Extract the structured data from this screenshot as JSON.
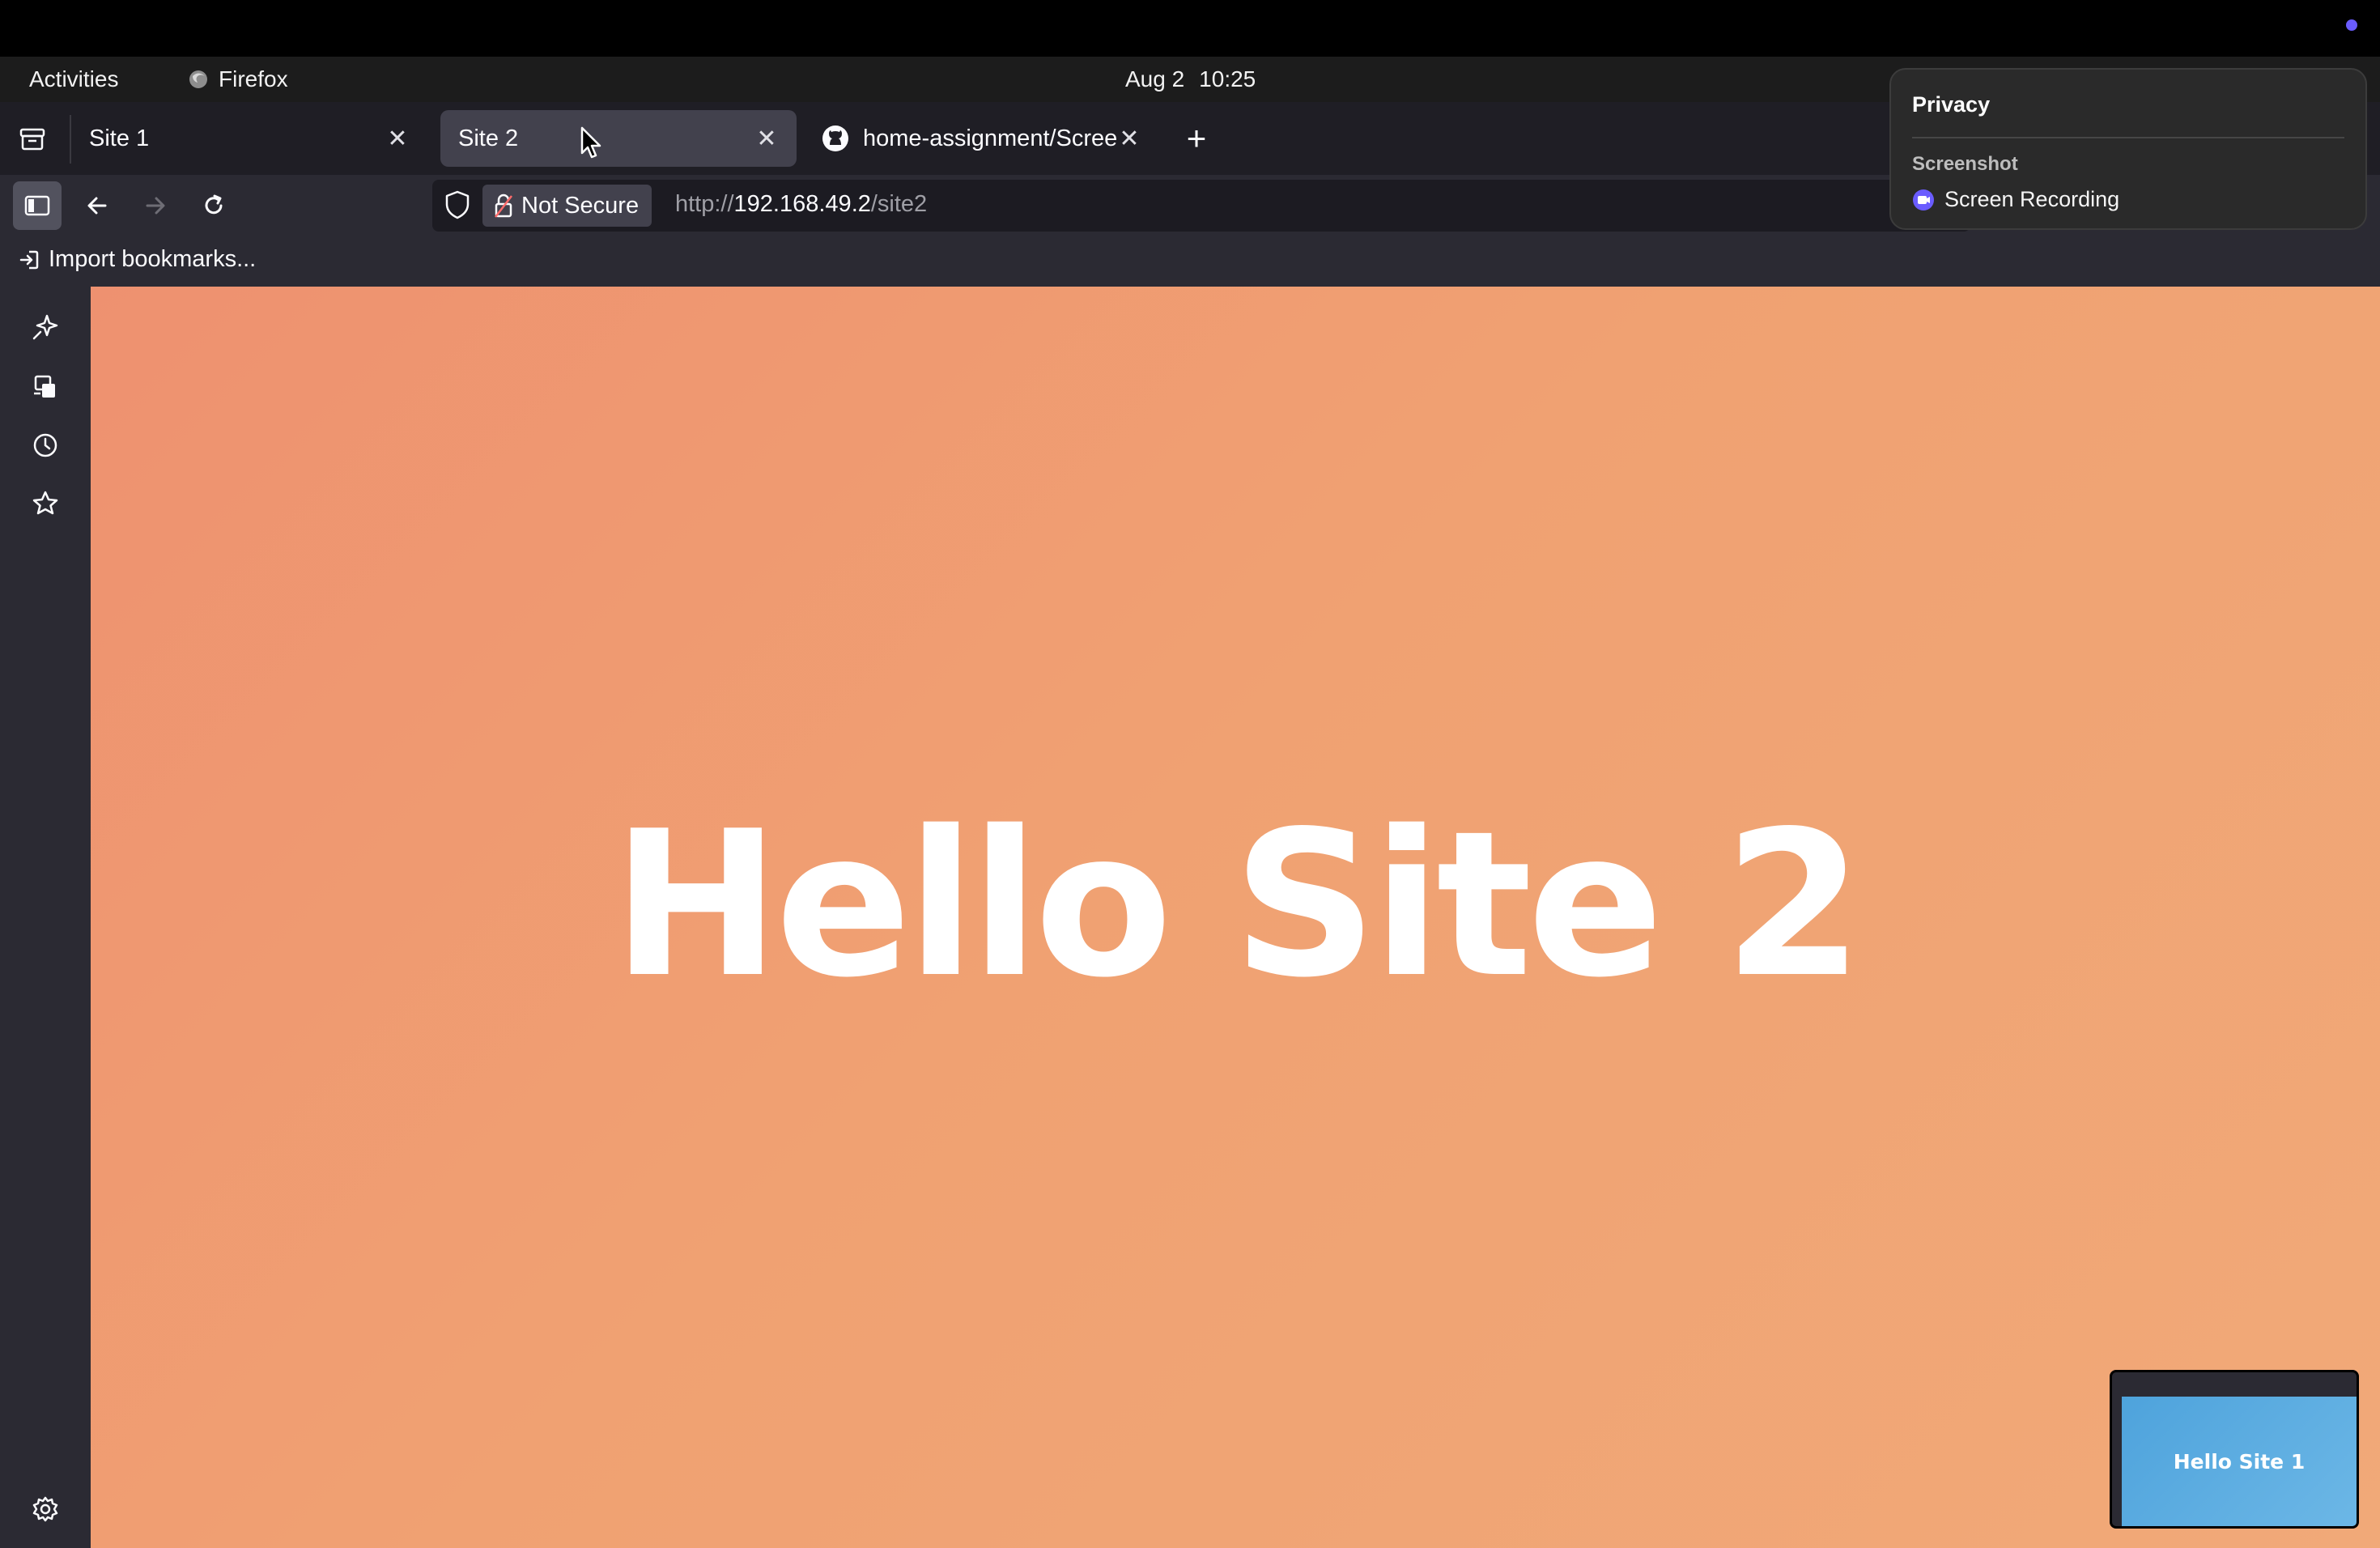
{
  "system_bar": {
    "activities": "Activities",
    "app_name": "Firefox",
    "date": "Aug 2",
    "time": "10:25"
  },
  "tabs": [
    {
      "title": "Site 1",
      "active": false
    },
    {
      "title": "Site 2",
      "active": true
    },
    {
      "title": "home-assignment/Screen",
      "active": false,
      "favicon": "github-icon"
    }
  ],
  "navigation": {
    "security_label": "Not Secure",
    "url_scheme": "http://",
    "url_host": "192.168.49.2",
    "url_path": "/site2"
  },
  "bookmarks_bar": {
    "import_label": "Import bookmarks..."
  },
  "sidebar": {
    "icons": [
      "ai-chatbot-icon",
      "synced-tabs-icon",
      "history-icon",
      "bookmarks-icon",
      "settings-icon"
    ]
  },
  "page": {
    "heading": "Hello Site 2",
    "background_colors": [
      "#ee9170",
      "#f1a978"
    ]
  },
  "privacy_popover": {
    "title": "Privacy",
    "section": "Screenshot",
    "item": "Screen Recording"
  },
  "thumbnail": {
    "text": "Hello Site 1",
    "background_color": "#5aaee0"
  }
}
